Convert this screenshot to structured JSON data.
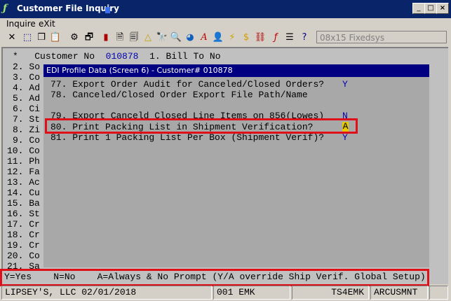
{
  "window": {
    "title": "Customer File Inquiry"
  },
  "menu": {
    "items": [
      "Inquire",
      "eXit"
    ]
  },
  "toolbar": {
    "font_selector": "08x15 Fixedsys"
  },
  "terminal": {
    "header": {
      "star": "*",
      "label": "Customer No",
      "number": "010878",
      "field": "1. Bill To No"
    },
    "left_items": [
      "2. So",
      "3. Co",
      "4. Ad",
      "5. Ad",
      "6. Ci",
      "7. St",
      "8. Zi",
      "9. Co",
      "10. Co",
      "11. Ph",
      "12. Fa",
      "13. Ac",
      "14. Cu",
      "15. Ba",
      "16. St",
      "17. Cr",
      "18. Cr",
      "19. Cr",
      "20. Co",
      "21. Sa"
    ]
  },
  "dialog": {
    "title": "EDI Profile Data (Screen 6) - Customer# 010878",
    "rows": [
      {
        "label": "77. Export Order Audit for Canceled/Closed Orders?",
        "value": "Y"
      },
      {
        "label": "78. Canceled/Closed Order Export File Path/Name",
        "value": ""
      },
      {
        "label": "79. Export Canceld Closed Line Items on 856(Lowes)",
        "value": "N"
      },
      {
        "label": "80. Print Packing List in Shipment Verification?",
        "value": "A"
      },
      {
        "label": "81. Print 1 Packing List Per Box (Shipment Verif)?",
        "value": "Y"
      }
    ]
  },
  "help_line": "Y=Yes    N=No    A=Always & No Prompt (Y/A override Ship Verif. Global Setup)",
  "status": {
    "company": "LIPSEY'S, LLC 02/01/2018",
    "code": "001 EMK",
    "terminal": "TS4EMK",
    "program": "ARCUSMNT"
  },
  "colors": {
    "titlebar": "#0a246a",
    "highlight": "#e0101a",
    "value_blue": "#0000b0",
    "cursor": "#e8c800"
  }
}
